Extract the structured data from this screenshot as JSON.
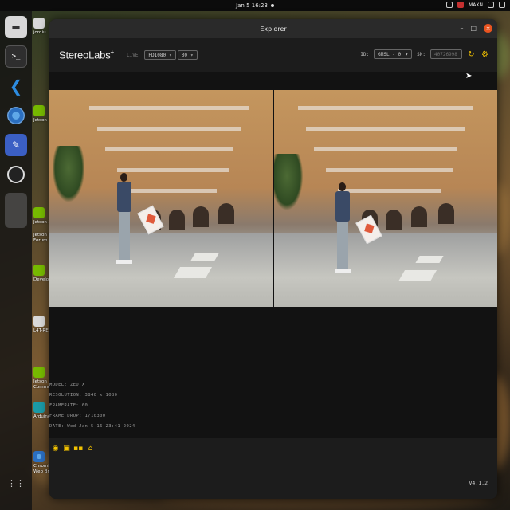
{
  "topbar": {
    "clock": "Jan 5  16:23",
    "tray_label": "MAXN"
  },
  "dock": {
    "items": [
      "files-icon",
      "terminal-icon",
      "vscode-icon",
      "chromium-icon",
      "text-editor-icon",
      "obs-icon",
      "app-icon",
      "trash-icon"
    ]
  },
  "desktop_icons": [
    {
      "label": "jordiu",
      "icon": "folder-icon"
    },
    {
      "label": "Jetson",
      "icon": "nvidia-icon"
    },
    {
      "label": "Jetson Zoo",
      "icon": "nvidia-icon"
    },
    {
      "label": "Jetson Deve Forum",
      "icon": "nvidia-icon"
    },
    {
      "label": "Develop",
      "icon": "nvidia-icon"
    },
    {
      "label": "L4T-RE",
      "icon": "folder-icon"
    },
    {
      "label": "Jetson Community",
      "icon": "nvidia-icon"
    },
    {
      "label": "Arduino IDE",
      "icon": "arduino-icon"
    },
    {
      "label": "Chromium Web Browser",
      "icon": "chromium-icon"
    }
  ],
  "window": {
    "title": "Explorer",
    "controls": {
      "minimize": "–",
      "maximize": "□",
      "close": "×"
    }
  },
  "appbar": {
    "logo": "StereoLabs",
    "logo_mark": "+",
    "mode": "LIVE",
    "resolution_select": "HD1080",
    "fps_select": "30",
    "id_label": "ID:",
    "id_value": "GMSL - 0",
    "sn_label": "SN:",
    "sn_value": "40726998"
  },
  "info": {
    "model": "MODEL: ZED X",
    "resolution": "RESOLUTION: 3840 x 1080",
    "framerate": "FRAMERATE: 60",
    "frame_drop": "FRAME DROP: 1/10300",
    "date": "DATE: Wed Jan 5 16:23:41 2024"
  },
  "footer": {
    "tools": [
      "folder-icon",
      "broadcast-icon",
      "record-icon",
      "stream-icon",
      "screenshot-icon"
    ],
    "version": "V4.1.2"
  },
  "colors": {
    "accent": "#f2c200",
    "window_bg": "#1c1c1c",
    "viewport_bg": "#121212",
    "close_button": "#e95420"
  }
}
